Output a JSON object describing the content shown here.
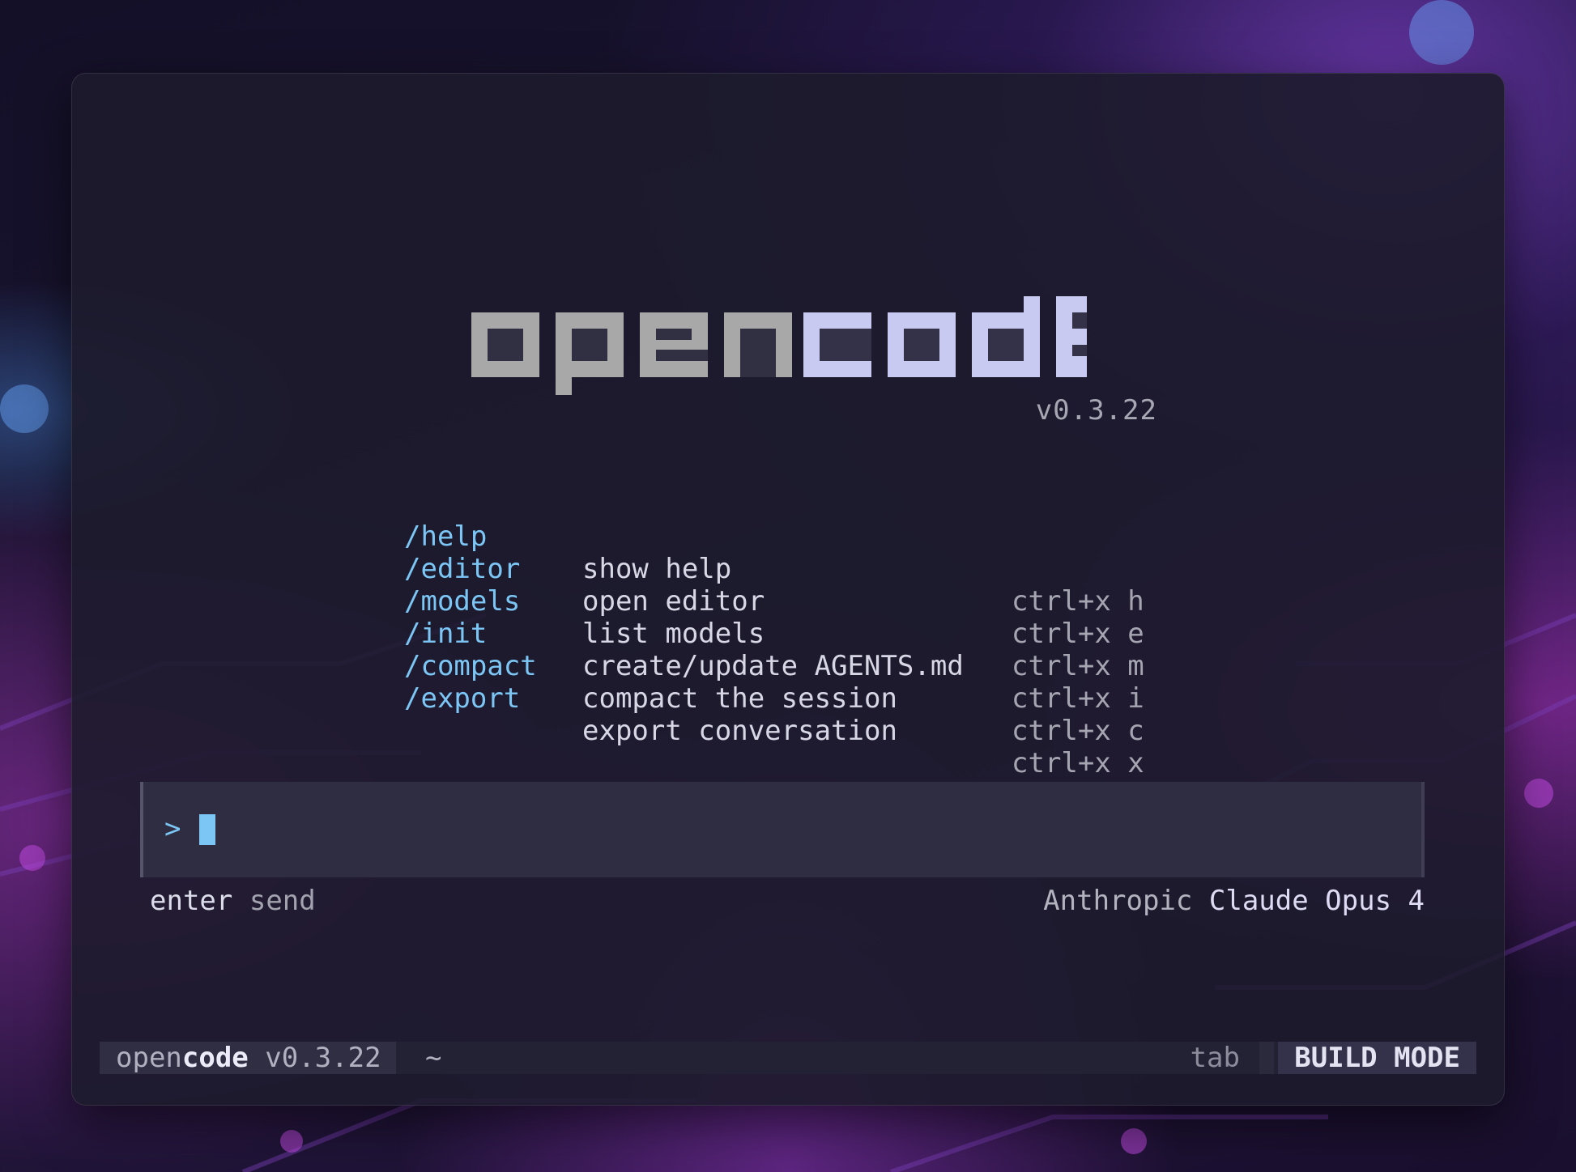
{
  "app": {
    "logo_text": "opencode",
    "version": "v0.3.22"
  },
  "commands": [
    {
      "name": "/help",
      "description": "show help",
      "shortcut": "ctrl+x h"
    },
    {
      "name": "/editor",
      "description": "open editor",
      "shortcut": "ctrl+x e"
    },
    {
      "name": "/models",
      "description": "list models",
      "shortcut": "ctrl+x m"
    },
    {
      "name": "/init",
      "description": "create/update AGENTS.md",
      "shortcut": "ctrl+x i"
    },
    {
      "name": "/compact",
      "description": "compact the session",
      "shortcut": "ctrl+x c"
    },
    {
      "name": "/export",
      "description": "export conversation",
      "shortcut": "ctrl+x x"
    }
  ],
  "prompt": {
    "symbol": ">",
    "value": ""
  },
  "hints": {
    "left_key": "enter",
    "left_action": "send",
    "provider": "Anthropic",
    "model": "Claude Opus 4"
  },
  "statusbar": {
    "app_prefix": "open",
    "app_suffix": "code",
    "version": "v0.3.22",
    "cwd": "~",
    "tab_hint": "tab",
    "mode": "BUILD MODE"
  },
  "colors": {
    "accent": "#7cc6f5",
    "logo_gray": "#a8a8a8",
    "logo_lavender": "#c9caf2",
    "panel": "#1d1b2c",
    "input_bg": "#2e2d42"
  }
}
